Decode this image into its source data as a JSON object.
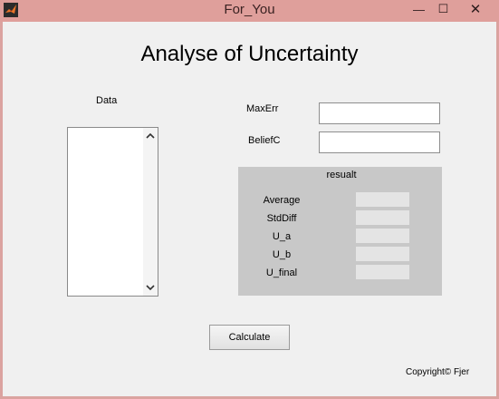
{
  "window": {
    "title": "For_You",
    "minimize_glyph": "—",
    "maximize_glyph": "☐",
    "close_glyph": "✕",
    "app_icon": "matlab-icon"
  },
  "heading": "Analyse of Uncertainty",
  "data_panel": {
    "label": "Data",
    "items": []
  },
  "inputs": {
    "maxerr_label": "MaxErr",
    "maxerr_value": "",
    "beliefc_label": "BeliefC",
    "beliefc_value": ""
  },
  "result_panel": {
    "title": "resualt",
    "rows": [
      {
        "label": "Average",
        "value": ""
      },
      {
        "label": "StdDiff",
        "value": ""
      },
      {
        "label": "U_a",
        "value": ""
      },
      {
        "label": "U_b",
        "value": ""
      },
      {
        "label": "U_final",
        "value": ""
      }
    ]
  },
  "calculate_label": "Calculate",
  "copyright": "Copyright© Fjer",
  "colors": {
    "titlebar": "#df9f9b",
    "panel": "#c8c8c8",
    "client": "#f0f0f0"
  }
}
